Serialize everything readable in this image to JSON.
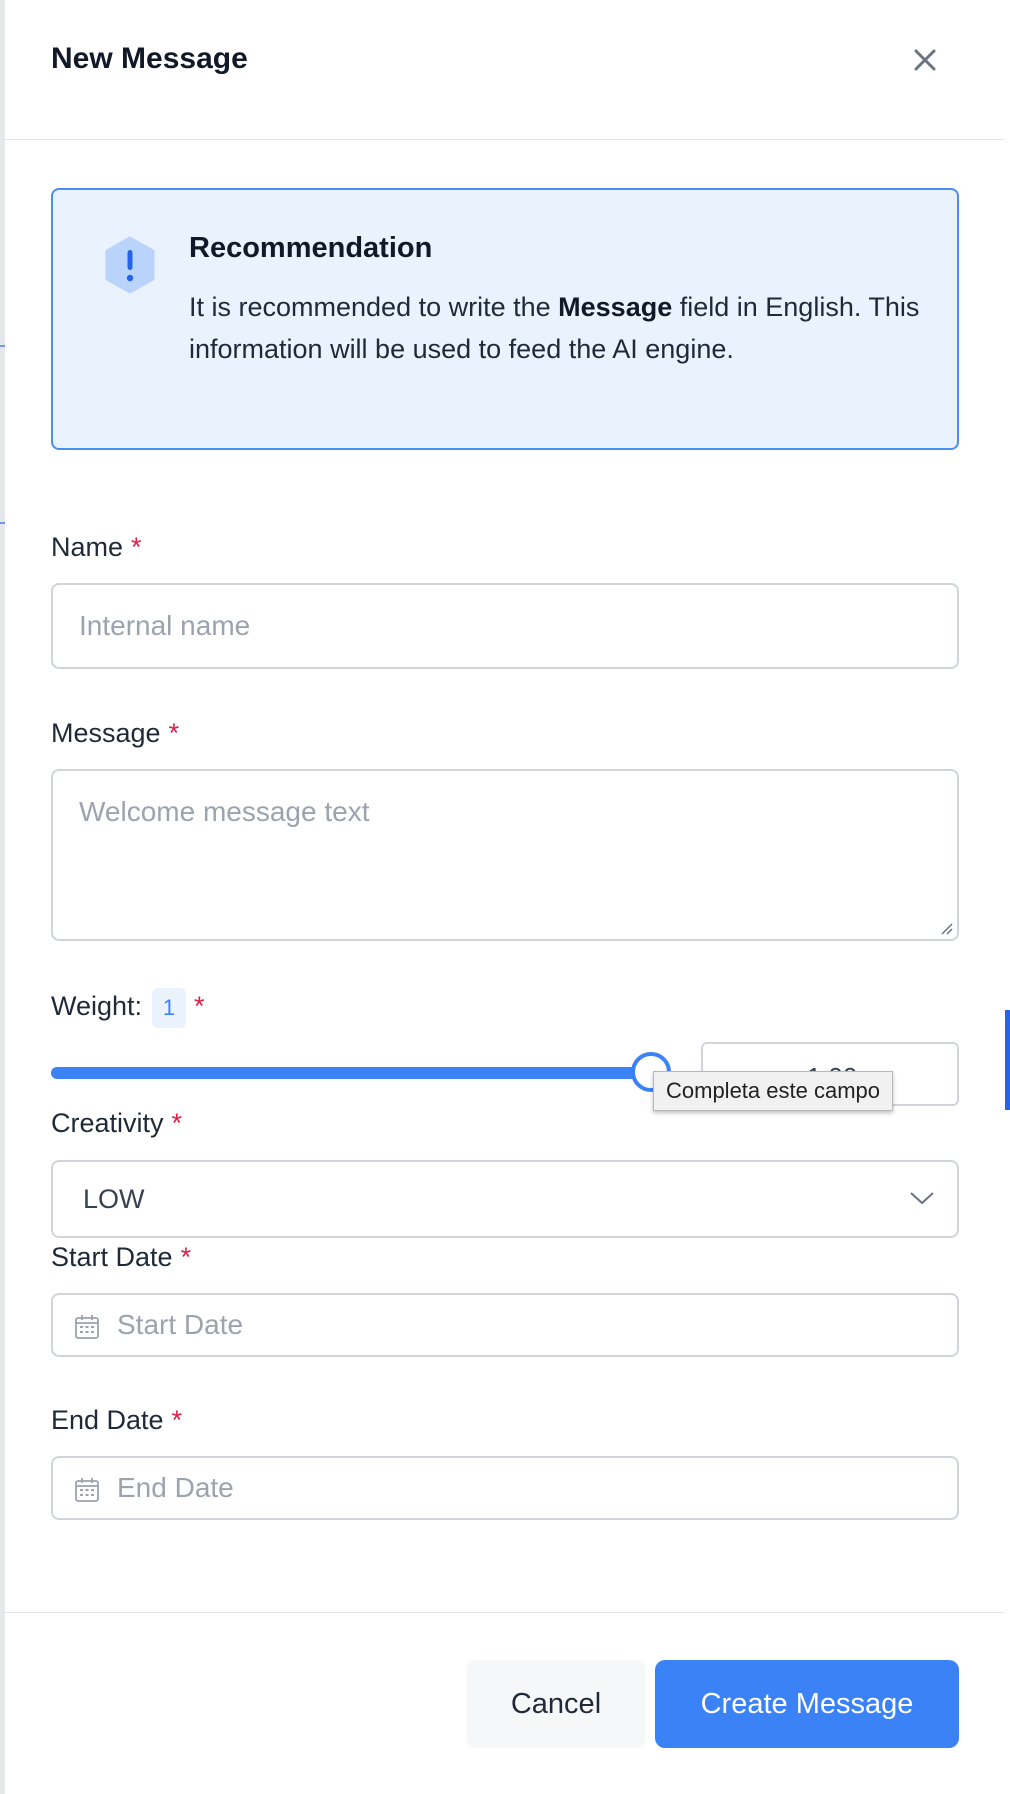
{
  "modal": {
    "title": "New Message",
    "close_icon": "close-icon"
  },
  "recommendation": {
    "icon": "alert-hexagon-icon",
    "title": "Recommendation",
    "body_pre": "It is recommended to write the ",
    "body_bold": "Message",
    "body_post": " field in English. This information will be used to feed the AI engine."
  },
  "form": {
    "name": {
      "label": "Name",
      "required_mark": "*",
      "placeholder": "Internal name",
      "value": ""
    },
    "message": {
      "label": "Message",
      "required_mark": "*",
      "placeholder": "Welcome message text",
      "value": ""
    },
    "weight": {
      "label": "Weight:",
      "badge": "1",
      "required_mark": "*",
      "slider_fraction": 1.0,
      "number_value": "1.00",
      "tooltip": "Completa este campo"
    },
    "creativity": {
      "label": "Creativity",
      "required_mark": "*",
      "selected": "LOW"
    },
    "start_date": {
      "label": "Start Date",
      "required_mark": "*",
      "placeholder": "Start Date"
    },
    "end_date": {
      "label": "End Date",
      "required_mark": "*",
      "placeholder": "End Date"
    }
  },
  "footer": {
    "cancel_label": "Cancel",
    "create_label": "Create Message"
  },
  "colors": {
    "accent": "#3b82f6",
    "alert_bg": "#eaf2fe",
    "alert_border": "#4a8ef2",
    "required": "#e11d48"
  }
}
